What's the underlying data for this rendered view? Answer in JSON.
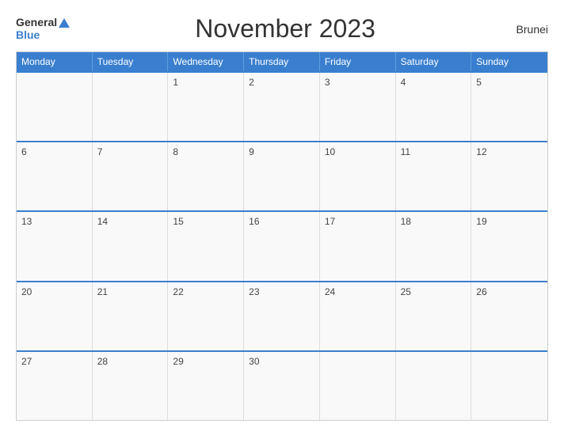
{
  "header": {
    "logo_general": "General",
    "logo_blue": "Blue",
    "title": "November 2023",
    "country": "Brunei"
  },
  "calendar": {
    "weekdays": [
      "Monday",
      "Tuesday",
      "Wednesday",
      "Thursday",
      "Friday",
      "Saturday",
      "Sunday"
    ],
    "weeks": [
      [
        {
          "day": "",
          "empty": true
        },
        {
          "day": "",
          "empty": true
        },
        {
          "day": "1",
          "empty": false
        },
        {
          "day": "2",
          "empty": false
        },
        {
          "day": "3",
          "empty": false
        },
        {
          "day": "4",
          "empty": false
        },
        {
          "day": "5",
          "empty": false
        }
      ],
      [
        {
          "day": "6",
          "empty": false
        },
        {
          "day": "7",
          "empty": false
        },
        {
          "day": "8",
          "empty": false
        },
        {
          "day": "9",
          "empty": false
        },
        {
          "day": "10",
          "empty": false
        },
        {
          "day": "11",
          "empty": false
        },
        {
          "day": "12",
          "empty": false
        }
      ],
      [
        {
          "day": "13",
          "empty": false
        },
        {
          "day": "14",
          "empty": false
        },
        {
          "day": "15",
          "empty": false
        },
        {
          "day": "16",
          "empty": false
        },
        {
          "day": "17",
          "empty": false
        },
        {
          "day": "18",
          "empty": false
        },
        {
          "day": "19",
          "empty": false
        }
      ],
      [
        {
          "day": "20",
          "empty": false
        },
        {
          "day": "21",
          "empty": false
        },
        {
          "day": "22",
          "empty": false
        },
        {
          "day": "23",
          "empty": false
        },
        {
          "day": "24",
          "empty": false
        },
        {
          "day": "25",
          "empty": false
        },
        {
          "day": "26",
          "empty": false
        }
      ],
      [
        {
          "day": "27",
          "empty": false
        },
        {
          "day": "28",
          "empty": false
        },
        {
          "day": "29",
          "empty": false
        },
        {
          "day": "30",
          "empty": false
        },
        {
          "day": "",
          "empty": true
        },
        {
          "day": "",
          "empty": true
        },
        {
          "day": "",
          "empty": true
        }
      ]
    ]
  }
}
